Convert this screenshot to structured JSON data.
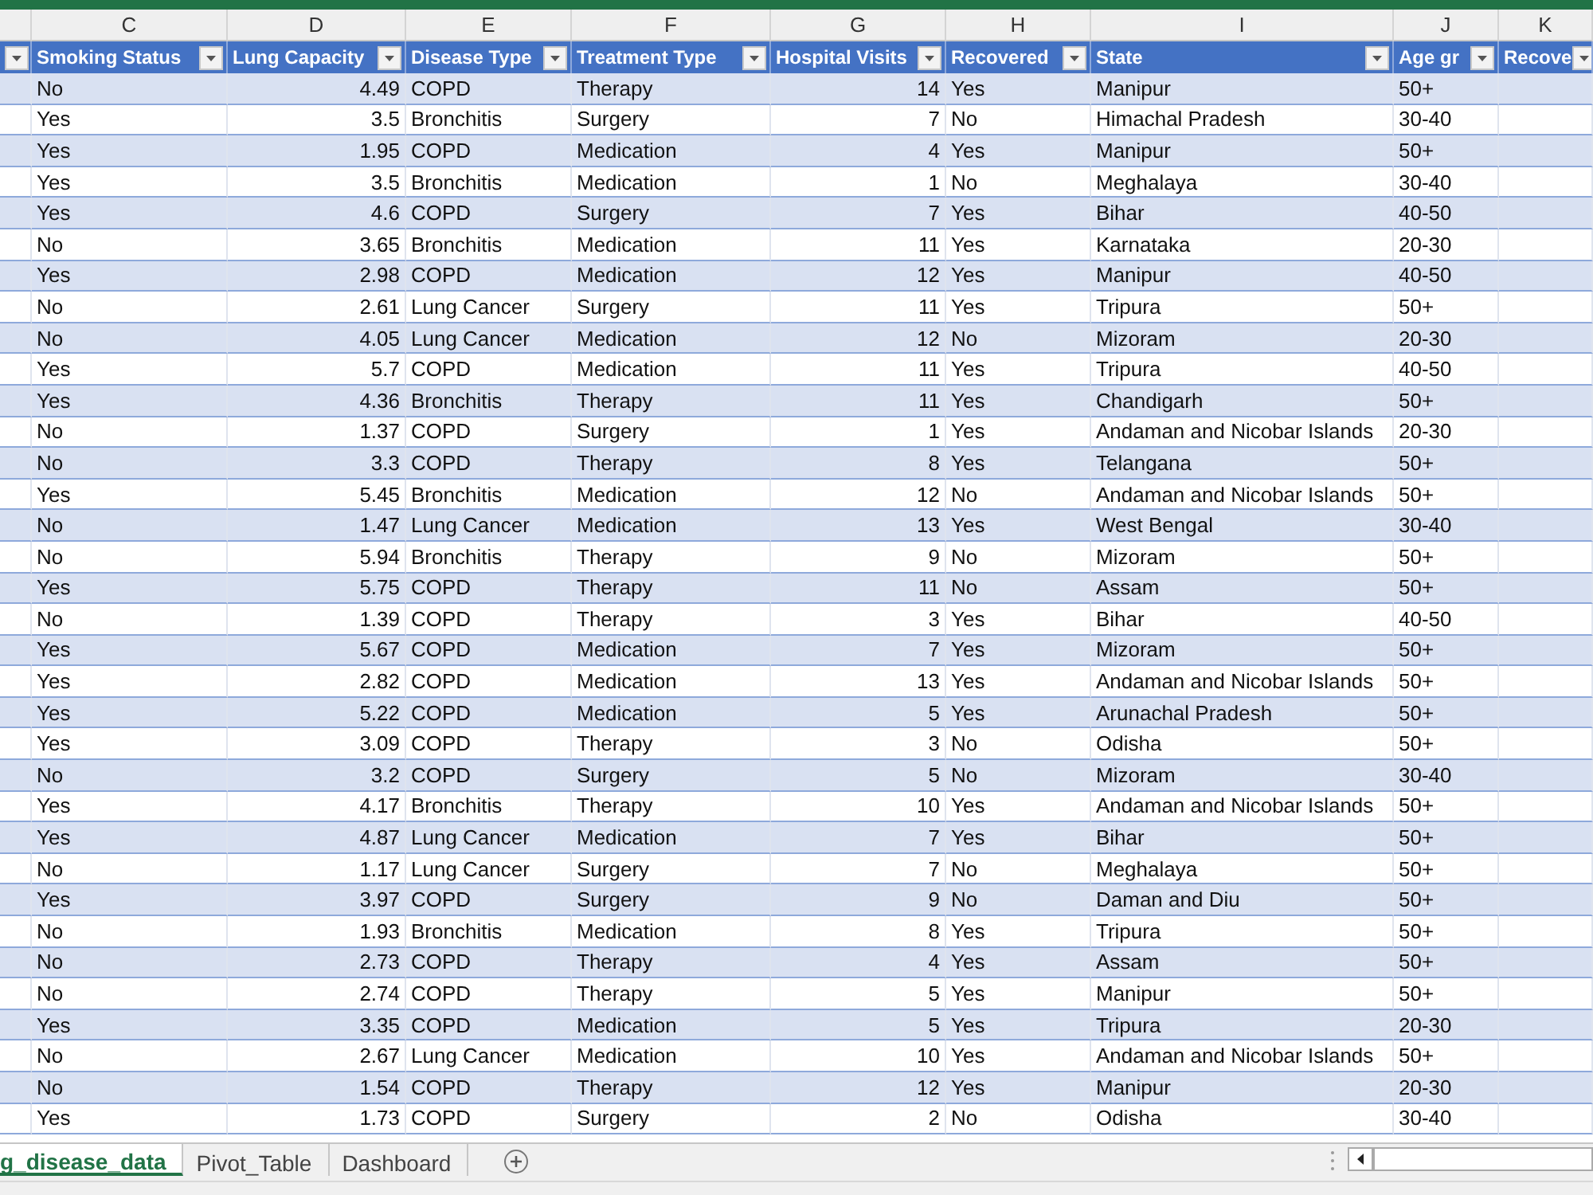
{
  "column_letters": [
    "C",
    "D",
    "E",
    "F",
    "G",
    "H",
    "I",
    "J",
    "K"
  ],
  "headers": [
    {
      "label": "Smoking Status"
    },
    {
      "label": "Lung Capacity"
    },
    {
      "label": "Disease Type"
    },
    {
      "label": "Treatment Type"
    },
    {
      "label": "Hospital Visits"
    },
    {
      "label": "Recovered"
    },
    {
      "label": "State"
    },
    {
      "label": "Age gr"
    },
    {
      "label": "Recove"
    }
  ],
  "rows": [
    [
      "No",
      "4.49",
      "COPD",
      "Therapy",
      "14",
      "Yes",
      "Manipur",
      "50+"
    ],
    [
      "Yes",
      "3.5",
      "Bronchitis",
      "Surgery",
      "7",
      "No",
      "Himachal Pradesh",
      "30-40"
    ],
    [
      "Yes",
      "1.95",
      "COPD",
      "Medication",
      "4",
      "Yes",
      "Manipur",
      "50+"
    ],
    [
      "Yes",
      "3.5",
      "Bronchitis",
      "Medication",
      "1",
      "No",
      "Meghalaya",
      "30-40"
    ],
    [
      "Yes",
      "4.6",
      "COPD",
      "Surgery",
      "7",
      "Yes",
      "Bihar",
      "40-50"
    ],
    [
      "No",
      "3.65",
      "Bronchitis",
      "Medication",
      "11",
      "Yes",
      "Karnataka",
      "20-30"
    ],
    [
      "Yes",
      "2.98",
      "COPD",
      "Medication",
      "12",
      "Yes",
      "Manipur",
      "40-50"
    ],
    [
      "No",
      "2.61",
      "Lung Cancer",
      "Surgery",
      "11",
      "Yes",
      "Tripura",
      "50+"
    ],
    [
      "No",
      "4.05",
      "Lung Cancer",
      "Medication",
      "12",
      "No",
      "Mizoram",
      "20-30"
    ],
    [
      "Yes",
      "5.7",
      "COPD",
      "Medication",
      "11",
      "Yes",
      "Tripura",
      "40-50"
    ],
    [
      "Yes",
      "4.36",
      "Bronchitis",
      "Therapy",
      "11",
      "Yes",
      "Chandigarh",
      "50+"
    ],
    [
      "No",
      "1.37",
      "COPD",
      "Surgery",
      "1",
      "Yes",
      "Andaman and Nicobar Islands",
      "20-30"
    ],
    [
      "No",
      "3.3",
      "COPD",
      "Therapy",
      "8",
      "Yes",
      "Telangana",
      "50+"
    ],
    [
      "Yes",
      "5.45",
      "Bronchitis",
      "Medication",
      "12",
      "No",
      "Andaman and Nicobar Islands",
      "50+"
    ],
    [
      "No",
      "1.47",
      "Lung Cancer",
      "Medication",
      "13",
      "Yes",
      "West Bengal",
      "30-40"
    ],
    [
      "No",
      "5.94",
      "Bronchitis",
      "Therapy",
      "9",
      "No",
      "Mizoram",
      "50+"
    ],
    [
      "Yes",
      "5.75",
      "COPD",
      "Therapy",
      "11",
      "No",
      "Assam",
      "50+"
    ],
    [
      "No",
      "1.39",
      "COPD",
      "Therapy",
      "3",
      "Yes",
      "Bihar",
      "40-50"
    ],
    [
      "Yes",
      "5.67",
      "COPD",
      "Medication",
      "7",
      "Yes",
      "Mizoram",
      "50+"
    ],
    [
      "Yes",
      "2.82",
      "COPD",
      "Medication",
      "13",
      "Yes",
      "Andaman and Nicobar Islands",
      "50+"
    ],
    [
      "Yes",
      "5.22",
      "COPD",
      "Medication",
      "5",
      "Yes",
      "Arunachal Pradesh",
      "50+"
    ],
    [
      "Yes",
      "3.09",
      "COPD",
      "Therapy",
      "3",
      "No",
      "Odisha",
      "50+"
    ],
    [
      "No",
      "3.2",
      "COPD",
      "Surgery",
      "5",
      "No",
      "Mizoram",
      "30-40"
    ],
    [
      "Yes",
      "4.17",
      "Bronchitis",
      "Therapy",
      "10",
      "Yes",
      "Andaman and Nicobar Islands",
      "50+"
    ],
    [
      "Yes",
      "4.87",
      "Lung Cancer",
      "Medication",
      "7",
      "Yes",
      "Bihar",
      "50+"
    ],
    [
      "No",
      "1.17",
      "Lung Cancer",
      "Surgery",
      "7",
      "No",
      "Meghalaya",
      "50+"
    ],
    [
      "Yes",
      "3.97",
      "COPD",
      "Surgery",
      "9",
      "No",
      "Daman and Diu",
      "50+"
    ],
    [
      "No",
      "1.93",
      "Bronchitis",
      "Medication",
      "8",
      "Yes",
      "Tripura",
      "50+"
    ],
    [
      "No",
      "2.73",
      "COPD",
      "Therapy",
      "4",
      "Yes",
      "Assam",
      "50+"
    ],
    [
      "No",
      "2.74",
      "COPD",
      "Therapy",
      "5",
      "Yes",
      "Manipur",
      "50+"
    ],
    [
      "Yes",
      "3.35",
      "COPD",
      "Medication",
      "5",
      "Yes",
      "Tripura",
      "20-30"
    ],
    [
      "No",
      "2.67",
      "Lung Cancer",
      "Medication",
      "10",
      "Yes",
      "Andaman and Nicobar Islands",
      "50+"
    ],
    [
      "No",
      "1.54",
      "COPD",
      "Therapy",
      "12",
      "Yes",
      "Manipur",
      "20-30"
    ],
    [
      "Yes",
      "1.73",
      "COPD",
      "Surgery",
      "2",
      "No",
      "Odisha",
      "30-40"
    ]
  ],
  "sheet_tabs": [
    {
      "label": "g_disease_data",
      "selected": true
    },
    {
      "label": "Pivot_Table",
      "selected": false
    },
    {
      "label": "Dashboard",
      "selected": false
    }
  ]
}
